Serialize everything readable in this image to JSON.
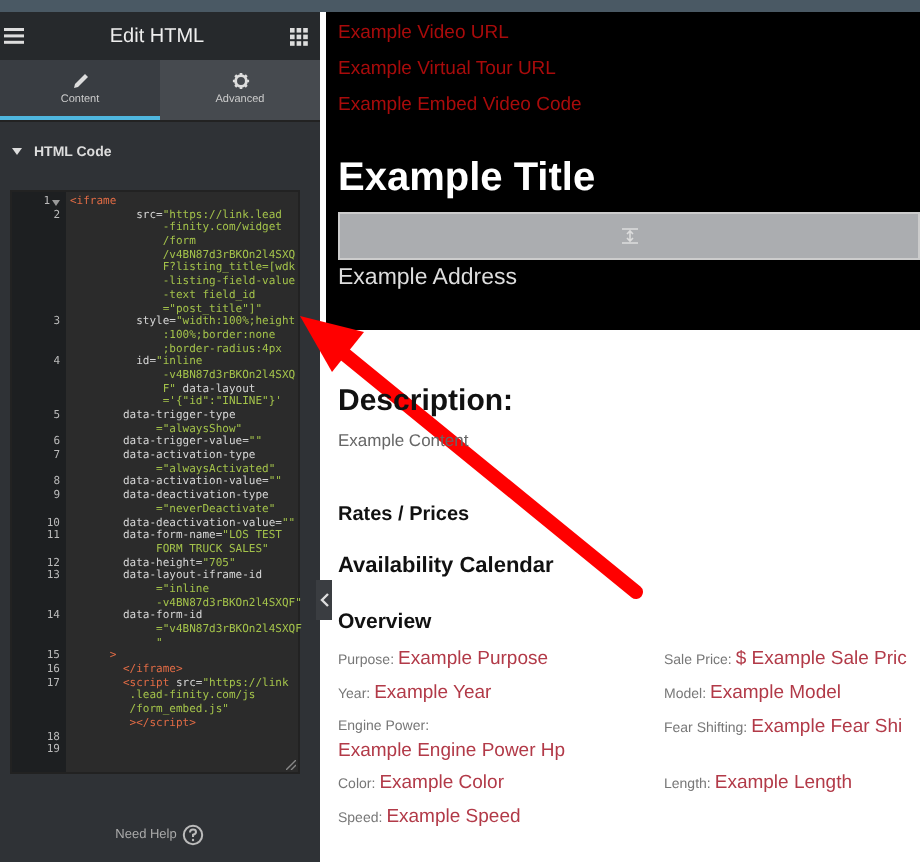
{
  "panel": {
    "title": "Edit HTML",
    "tabs": [
      {
        "label": "Content",
        "kind": "pencil",
        "selected": true
      },
      {
        "label": "Advanced",
        "kind": "gear",
        "selected": false
      }
    ],
    "section": {
      "title": "HTML Code",
      "expanded": true
    },
    "code_lines": [
      {
        "number": "1",
        "fold_marker": true,
        "rows": [
          [
            {
              "kind": "tag",
              "text": "<iframe"
            }
          ]
        ]
      },
      {
        "number": "2",
        "rows": [
          [
            {
              "kind": "attr",
              "text": "          src="
            },
            {
              "kind": "string",
              "text": "\"https://link.lead"
            }
          ],
          [
            {
              "kind": "string",
              "text": "              -finity.com/widget"
            }
          ],
          [
            {
              "kind": "string",
              "text": "              /form"
            }
          ],
          [
            {
              "kind": "string",
              "text": "              /v4BN87d3rBKOn2l4SXQ"
            }
          ],
          [
            {
              "kind": "string",
              "text": "              F?listing_title=[wdk"
            }
          ],
          [
            {
              "kind": "string",
              "text": "              -listing-field-value"
            }
          ],
          [
            {
              "kind": "string",
              "text": "              -text field_id"
            }
          ],
          [
            {
              "kind": "string",
              "text": "              =\"post_title\"]\""
            }
          ]
        ]
      },
      {
        "number": "3",
        "rows": [
          [
            {
              "kind": "attr",
              "text": "          style="
            },
            {
              "kind": "string",
              "text": "\"width:100%;height"
            }
          ],
          [
            {
              "kind": "string",
              "text": "              :100%;border:none"
            }
          ],
          [
            {
              "kind": "string",
              "text": "              ;border-radius:4px"
            }
          ]
        ]
      },
      {
        "number": "4",
        "rows": [
          [
            {
              "kind": "attr",
              "text": "          id="
            },
            {
              "kind": "string",
              "text": "\"inline"
            }
          ],
          [
            {
              "kind": "string",
              "text": "              -v4BN87d3rBKOn2l4SXQ"
            }
          ],
          [
            {
              "kind": "string",
              "text": "              F\""
            },
            {
              "kind": "attr",
              "text": " data-layout"
            }
          ],
          [
            {
              "kind": "string",
              "text": "              ='{\"id\":\"INLINE\"}'"
            }
          ]
        ]
      },
      {
        "number": "5",
        "rows": [
          [
            {
              "kind": "attr",
              "text": "        data-trigger-type"
            }
          ],
          [
            {
              "kind": "string",
              "text": "             =\"alwaysShow\""
            }
          ]
        ]
      },
      {
        "number": "6",
        "rows": [
          [
            {
              "kind": "attr",
              "text": "        data-trigger-value="
            },
            {
              "kind": "string",
              "text": "\"\""
            }
          ]
        ]
      },
      {
        "number": "7",
        "rows": [
          [
            {
              "kind": "attr",
              "text": "        data-activation-type"
            }
          ],
          [
            {
              "kind": "string",
              "text": "             =\"alwaysActivated\""
            }
          ]
        ]
      },
      {
        "number": "8",
        "rows": [
          [
            {
              "kind": "attr",
              "text": "        data-activation-value="
            },
            {
              "kind": "string",
              "text": "\"\""
            }
          ]
        ]
      },
      {
        "number": "9",
        "rows": [
          [
            {
              "kind": "attr",
              "text": "        data-deactivation-type"
            }
          ],
          [
            {
              "kind": "string",
              "text": "             =\"neverDeactivate\""
            }
          ]
        ]
      },
      {
        "number": "10",
        "rows": [
          [
            {
              "kind": "attr",
              "text": "        data-deactivation-value="
            },
            {
              "kind": "string",
              "text": "\"\""
            }
          ]
        ]
      },
      {
        "number": "11",
        "rows": [
          [
            {
              "kind": "attr",
              "text": "        data-form-name="
            },
            {
              "kind": "string",
              "text": "\"LOS TEST"
            }
          ],
          [
            {
              "kind": "string",
              "text": "             FORM TRUCK SALES\""
            }
          ]
        ]
      },
      {
        "number": "12",
        "rows": [
          [
            {
              "kind": "attr",
              "text": "        data-height="
            },
            {
              "kind": "string",
              "text": "\"705\""
            }
          ]
        ]
      },
      {
        "number": "13",
        "rows": [
          [
            {
              "kind": "attr",
              "text": "        data-layout-iframe-id"
            }
          ],
          [
            {
              "kind": "string",
              "text": "             =\"inline"
            }
          ],
          [
            {
              "kind": "string",
              "text": "             -v4BN87d3rBKOn2l4SXQF\""
            }
          ]
        ]
      },
      {
        "number": "14",
        "rows": [
          [
            {
              "kind": "attr",
              "text": "        data-form-id"
            }
          ],
          [
            {
              "kind": "string",
              "text": "             =\"v4BN87d3rBKOn2l4SXQF"
            }
          ],
          [
            {
              "kind": "string",
              "text": "             \""
            }
          ]
        ]
      },
      {
        "number": "15",
        "rows": [
          [
            {
              "kind": "tag",
              "text": "      >"
            }
          ]
        ]
      },
      {
        "number": "16",
        "rows": [
          [
            {
              "kind": "tag",
              "text": "        </iframe>"
            }
          ]
        ]
      },
      {
        "number": "17",
        "rows": [
          [
            {
              "kind": "tag",
              "text": "        <script"
            },
            {
              "kind": "attr",
              "text": " src="
            },
            {
              "kind": "string",
              "text": "\"https://link"
            }
          ],
          [
            {
              "kind": "string",
              "text": "         .lead-finity.com/js"
            }
          ],
          [
            {
              "kind": "string",
              "text": "         /form_embed.js\""
            }
          ],
          [
            {
              "kind": "tag",
              "text": "         ></script>"
            }
          ]
        ]
      },
      {
        "number": "18",
        "rows": [
          []
        ]
      },
      {
        "number": "19",
        "rows": [
          []
        ]
      }
    ],
    "help": "Need Help"
  },
  "preview": {
    "links": [
      "Example Video URL",
      "Example Virtual Tour URL",
      "Example Embed Video Code"
    ],
    "title": "Example Title",
    "address": "Example Address",
    "description_heading": "Description:",
    "description": "Example Content",
    "rates_heading": "Rates / Prices",
    "calendar_heading": "Availability Calendar",
    "overview_heading": "Overview",
    "overview_fields": [
      {
        "label": "Purpose:",
        "value": "Example Purpose"
      },
      {
        "label": "Sale Price:",
        "value": "$ Example Sale Pric"
      },
      {
        "label": "Year:",
        "value": "Example Year"
      },
      {
        "label": "Model:",
        "value": "Example Model"
      },
      {
        "label": "Engine Power:",
        "value": "Example Engine Power Hp"
      },
      {
        "label": "Fear Shifting:",
        "value": "Example Fear Shi"
      },
      {
        "label": "Color:",
        "value": "Example Color"
      },
      {
        "label": "Length:",
        "value": "Example Length"
      },
      {
        "label": "Speed:",
        "value": "Example Speed"
      }
    ]
  }
}
